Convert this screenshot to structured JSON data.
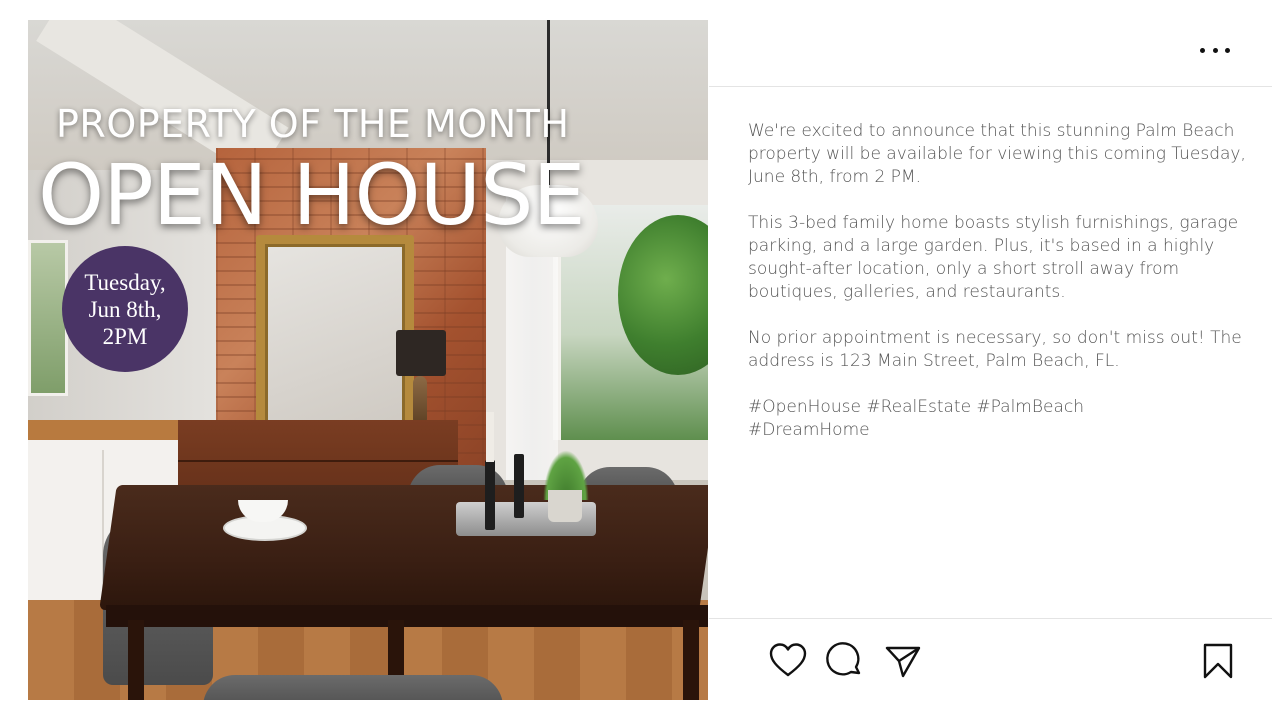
{
  "post_image": {
    "header_small": "PROPERTY OF THE MONTH",
    "header_big": "OPEN HOUSE",
    "date_badge": "Tuesday,\nJun 8th,\n2PM",
    "badge_color": "#4a3466"
  },
  "top_bar": {
    "more_icon": "more-horizontal-icon"
  },
  "caption": {
    "paragraphs": [
      "We're excited to announce that this stunning Palm Beach property will be available for viewing this coming Tuesday, June 8th, from 2 PM.",
      "This 3-bed family home boasts stylish furnishings, garage parking, and a large garden. Plus, it's based in a highly sought-after location, only a short stroll away from boutiques, galleries, and restaurants.",
      "No prior appointment is necessary, so don't miss out! The address is 123 Main Street, Palm Beach, FL."
    ],
    "hashtags": "#OpenHouse #RealEstate #PalmBeach\n#DreamHome"
  },
  "actions": {
    "like_icon": "heart-icon",
    "comment_icon": "comment-icon",
    "share_icon": "send-icon",
    "save_icon": "bookmark-icon"
  }
}
